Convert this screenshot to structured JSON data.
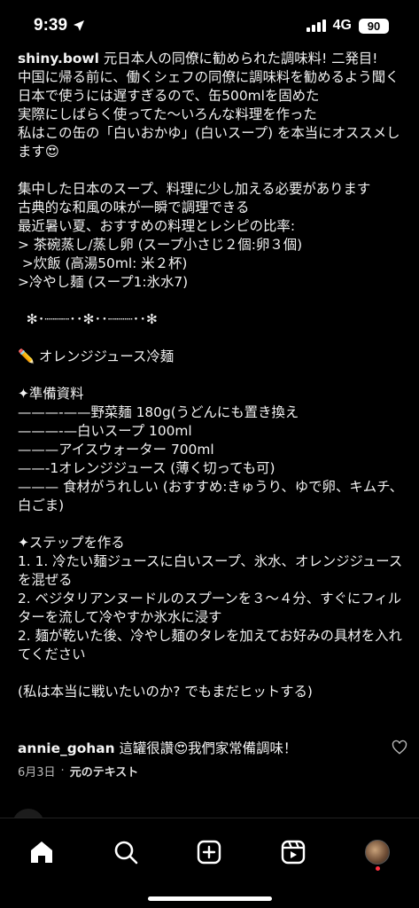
{
  "status": {
    "time": "9:39",
    "network": "4G",
    "battery": "90"
  },
  "caption": {
    "username": "shiny.bowl",
    "first_line": "元日本人の同僚に勧められた調味料! 二発目!",
    "lines": [
      "中国に帰る前に、働くシェフの同僚に調味料を勧めるよう聞く",
      "日本で使うには遅すぎるので、缶500mlを固めた",
      "実際にしばらく使ってた〜いろんな料理を作った",
      "私はこの缶の「白いおかゆ」(白いスープ) を本当にオススメします😍",
      "",
      "集中した日本のスープ、料理に少し加える必要があります",
      "古典的な和風の味が一瞬で調理できる",
      "最近暑い夏、おすすめの料理とレシピの比率:",
      "> 茶碗蒸し/蒸し卵 (スープ小さじ２個:卵３個)",
      " >炊飯 (高湯50ml: 米２杯)",
      ">冷やし麺 (スープ1:氷水7)",
      "",
      "  ✻･┈┈┈･･✻･･┈┈┈･･✻",
      "",
      "✏️ オレンジジュース冷麺",
      "",
      "✦準備資料",
      "———-——野菜麺 180g(うどんにも置き換え",
      "———-—白いスープ 100ml",
      "———アイスウォーター 700ml",
      "——-1オレンジジュース (薄く切っても可)",
      "——— 食材がうれしい (おすすめ:きゅうり、ゆで卵、キムチ、白ごま)",
      "",
      "✦ステップを作る",
      "1. 1. 冷たい麺ジュースに白いスープ、氷水、オレンジジュースを混ぜる",
      "2. ベジタリアンヌードルのスプーンを３～４分、すぐにフィルターを流して冷やすか氷水に浸す",
      "2. 麺が乾いた後、冷やし麺のタレを加えてお好みの具材を入れてください",
      "",
      "(私は本当に戦いたいのか? でもまだヒットする)"
    ]
  },
  "comment": {
    "username": "annie_gohan",
    "text": "這罐很讚😍我們家常備調味！"
  },
  "meta": {
    "date": "6月3日",
    "separator": "·",
    "see_original": "元のテキスト"
  },
  "icons": {
    "home": "home-icon",
    "search": "search-icon",
    "create": "create-icon",
    "reels": "reels-icon",
    "profile": "profile-avatar"
  },
  "colors": {
    "background": "#000000",
    "text": "#f2f2f2",
    "notification": "#ff3040"
  }
}
